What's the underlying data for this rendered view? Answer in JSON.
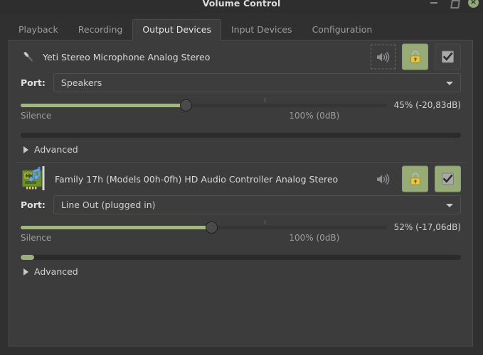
{
  "window": {
    "title": "Volume Control",
    "controls": [
      {
        "name": "minimize-button",
        "glyph": "minimize"
      },
      {
        "name": "maximize-button",
        "glyph": "maximize"
      },
      {
        "name": "close-button",
        "glyph": "×"
      }
    ],
    "close_color": "#8fa876"
  },
  "tabs": [
    {
      "label": "Playback",
      "active": false
    },
    {
      "label": "Recording",
      "active": false
    },
    {
      "label": "Output Devices",
      "active": true
    },
    {
      "label": "Input Devices",
      "active": false
    },
    {
      "label": "Configuration",
      "active": false
    }
  ],
  "colors": {
    "accent_green": "#97ab77",
    "slider_fill": "#a3b583",
    "meter_fill": "#9cb07e",
    "panel_bg": "#3c3c3c",
    "window_bg": "#303030",
    "text": "#d3d4d3",
    "muted_text": "#9b9c9b"
  },
  "devices": [
    {
      "icon": "microphone-icon",
      "name": "Yeti Stereo Microphone Analog Stereo",
      "mute": {
        "icon": "speaker-icon",
        "focused": true,
        "active": false
      },
      "lock": {
        "icon": "lock-icon",
        "active": true
      },
      "default": {
        "icon": "checkmark-icon",
        "active": false
      },
      "port_label": "Port:",
      "port_value": "Speakers",
      "slider": {
        "percent": 45,
        "value_label": "45% (-20,83dB)",
        "min_label": "Silence",
        "base_label": "100% (0dB)",
        "base_percent": 66.7
      },
      "meter_percent": 0,
      "advanced_label": "Advanced",
      "advanced_expanded": false
    },
    {
      "icon": "soundcard-icon",
      "name": "Family 17h (Models 00h-0fh) HD Audio Controller Analog Stereo",
      "mute": {
        "icon": "speaker-icon",
        "focused": false,
        "active": false
      },
      "lock": {
        "icon": "lock-icon",
        "active": true
      },
      "default": {
        "icon": "checkmark-icon",
        "active": true
      },
      "port_label": "Port:",
      "port_value": "Line Out (plugged in)",
      "slider": {
        "percent": 52,
        "value_label": "52% (-17,06dB)",
        "min_label": "Silence",
        "base_label": "100% (0dB)",
        "base_percent": 66.7
      },
      "meter_percent": 3,
      "advanced_label": "Advanced",
      "advanced_expanded": false
    }
  ]
}
